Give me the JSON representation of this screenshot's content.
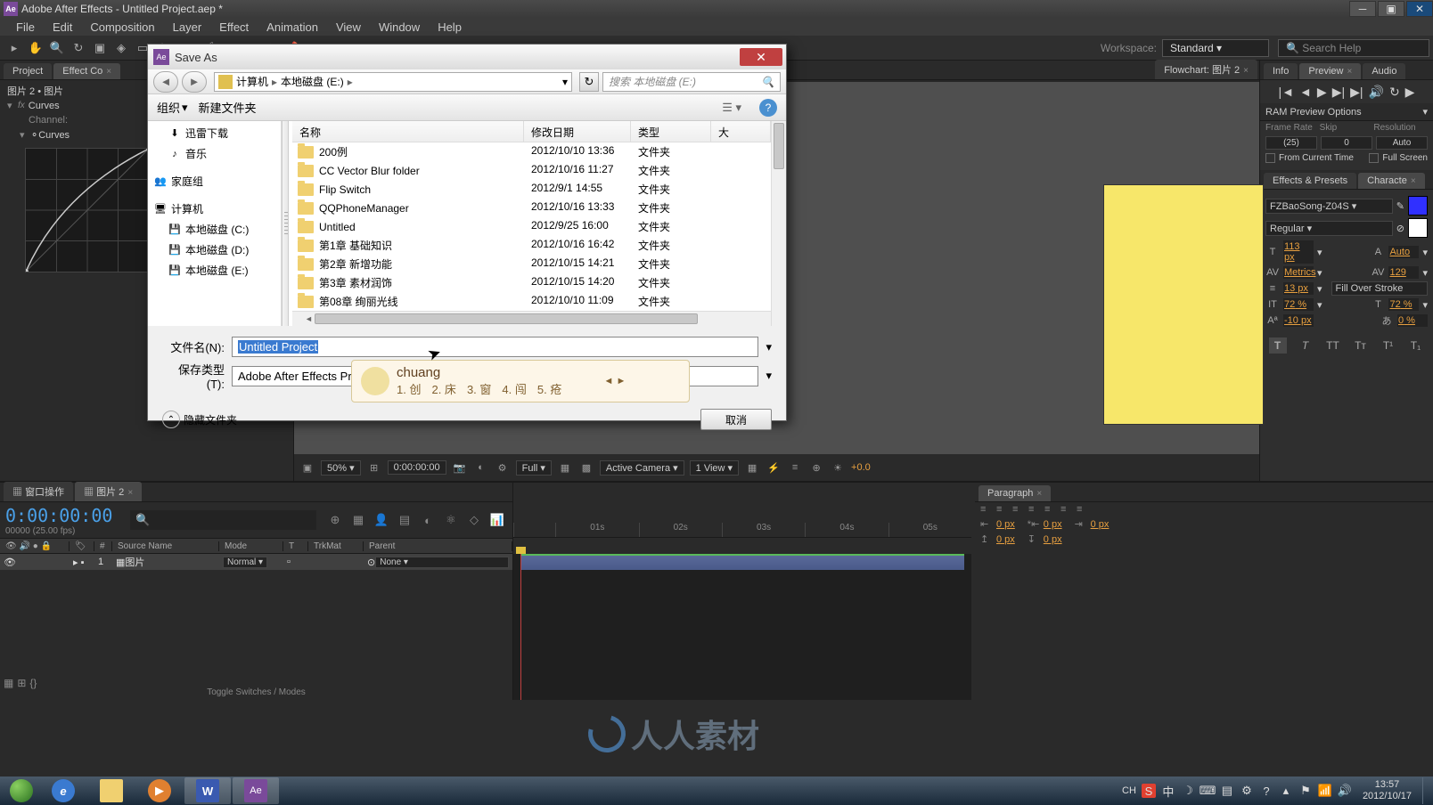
{
  "title_bar": {
    "app_icon": "Ae",
    "title": "Adobe After Effects - Untitled Project.aep *"
  },
  "menu": [
    "File",
    "Edit",
    "Composition",
    "Layer",
    "Effect",
    "Animation",
    "View",
    "Window",
    "Help"
  ],
  "tool_bar": {
    "workspace_label": "Workspace:",
    "workspace_value": "Standard",
    "search_placeholder": "Search Help"
  },
  "left_tabs": {
    "project": "Project",
    "effects": "Effect Co"
  },
  "effects_panel": {
    "comp_name": "图片 2 • 图片",
    "curves": "Curves",
    "channel_label": "Channel:",
    "curves_sub": "Curves"
  },
  "flowchart_tab": "Flowchart: 图片  2",
  "comp_controls": {
    "zoom": "50%",
    "timecode": "0:00:00:00",
    "view_full": "Full",
    "camera": "Active Camera",
    "view_count": "1 View",
    "offset": "+0.0"
  },
  "right_tabs": [
    "Info",
    "Preview",
    "Audio"
  ],
  "ram": {
    "label": "RAM Preview Options",
    "col1": "Frame Rate",
    "col2": "Skip",
    "col3": "Resolution",
    "v1": "(25)",
    "v2": "0",
    "v3": "Auto",
    "cb1": "From Current Time",
    "cb2": "Full Screen"
  },
  "ep_tabs": [
    "Effects & Presets",
    "Characte"
  ],
  "char": {
    "font": "FZBaoSong-Z04S",
    "weight": "Regular",
    "size_val": "113",
    "size_unit": "px",
    "leading": "Auto",
    "kerning": "Metrics",
    "tracking": "129",
    "stroke_w": "13",
    "stroke_mode": "Fill Over Stroke",
    "vscale": "72",
    "hscale": "72",
    "baseline": "-10",
    "tsume": "0"
  },
  "timeline": {
    "tab1": "窗口操作",
    "tab2": "图片 2",
    "timecode": "0:00:00:00",
    "frame_info": "00000 (25.00 fps)",
    "col_num": "#",
    "col_src": "Source Name",
    "col_mode": "Mode",
    "col_t": "T",
    "col_trk": "TrkMat",
    "col_parent": "Parent",
    "layer_num": "1",
    "layer_name": "图片",
    "layer_mode": "Normal",
    "layer_parent": "None",
    "ticks": [
      "01s",
      "02s",
      "03s",
      "04s",
      "05s"
    ],
    "toggle": "Toggle Switches / Modes"
  },
  "para": {
    "tab": "Paragraph",
    "v1": "0 px",
    "v2": "0 px",
    "v3": "0 px",
    "v4": "0 px",
    "v5": "0 px"
  },
  "dialog": {
    "title": "Save As",
    "bc1": "计算机",
    "bc2": "本地磁盘 (E:)",
    "search_placeholder": "搜索 本地磁盘 (E:)",
    "organize": "组织",
    "new_folder": "新建文件夹",
    "col_name": "名称",
    "col_date": "修改日期",
    "col_type": "类型",
    "col_size": "大",
    "tree": {
      "downloads": "迅雷下载",
      "music": "音乐",
      "homegroup": "家庭组",
      "computer": "计算机",
      "drive_c": "本地磁盘 (C:)",
      "drive_d": "本地磁盘 (D:)",
      "drive_e": "本地磁盘 (E:)"
    },
    "files": [
      {
        "name": "200例",
        "date": "2012/10/10 13:36",
        "type": "文件夹"
      },
      {
        "name": "CC Vector Blur folder",
        "date": "2012/10/16 11:27",
        "type": "文件夹"
      },
      {
        "name": "Flip Switch",
        "date": "2012/9/1 14:55",
        "type": "文件夹"
      },
      {
        "name": "QQPhoneManager",
        "date": "2012/10/16 13:33",
        "type": "文件夹"
      },
      {
        "name": "Untitled",
        "date": "2012/9/25 16:00",
        "type": "文件夹"
      },
      {
        "name": "第1章 基础知识",
        "date": "2012/10/16 16:42",
        "type": "文件夹"
      },
      {
        "name": "第2章 新增功能",
        "date": "2012/10/15 14:21",
        "type": "文件夹"
      },
      {
        "name": "第3章 素材润饰",
        "date": "2012/10/15 14:20",
        "type": "文件夹"
      },
      {
        "name": "第08章 绚丽光线",
        "date": "2012/10/10 11:09",
        "type": "文件夹"
      }
    ],
    "filename_label": "文件名(N):",
    "filename_value": "Untitled Project",
    "filetype_label": "保存类型(T):",
    "filetype_value": "Adobe After Effects Project",
    "hide_folders": "隐藏文件夹",
    "cancel": "取消"
  },
  "ime": {
    "input": "chuang",
    "candidates": [
      "1. 创",
      "2. 床",
      "3. 窗",
      "4. 闯",
      "5. 疮"
    ]
  },
  "tray": {
    "lang": "CH",
    "time": "13:57",
    "date": "2012/10/17"
  },
  "watermark": "人人素材"
}
